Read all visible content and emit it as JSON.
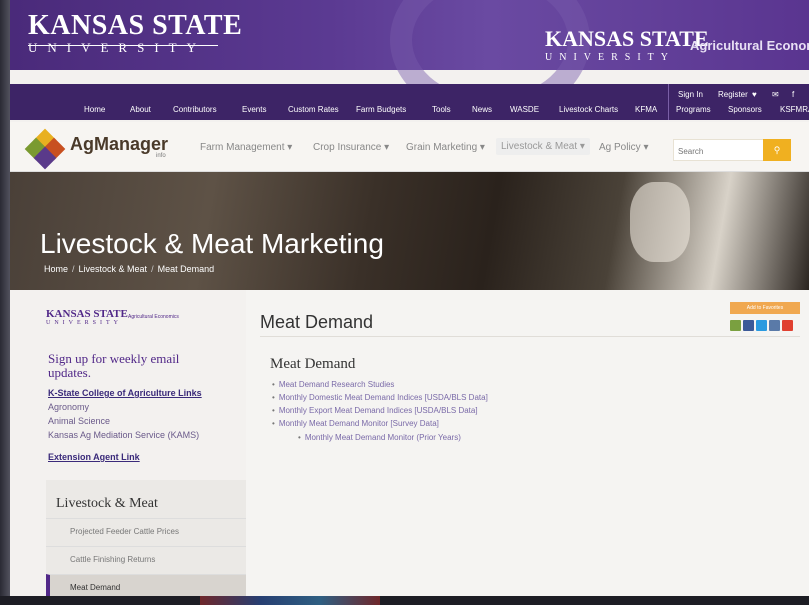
{
  "ksu": {
    "logo_big": "KANSAS STATE",
    "logo_small": "UNIVERSITY",
    "right_big": "KANSAS STATE",
    "right_small": "UNIVERSITY",
    "right_sub": "Agricultural Economic"
  },
  "topnav": {
    "items": [
      "Home",
      "About",
      "Contributors",
      "Events",
      "Custom Rates",
      "Farm Budgets",
      "Tools",
      "News",
      "WASDE",
      "Livestock Charts",
      "KFMA",
      "Programs",
      "Sponsors",
      "KSFMRA"
    ],
    "top_right": [
      "Sign In",
      "Register"
    ]
  },
  "agmanager": {
    "name": "AgManager",
    "sub": "info",
    "menus": [
      "Farm Management ▾",
      "Crop Insurance ▾",
      "Grain Marketing ▾",
      "Livestock & Meat ▾",
      "Ag Policy ▾"
    ],
    "search_placeholder": "Search",
    "search_icon": "search-icon"
  },
  "hero": {
    "title": "Livestock & Meat Marketing",
    "crumbs": [
      "Home",
      "Livestock & Meat",
      "Meat Demand"
    ]
  },
  "sidebar": {
    "logo_big": "KANSAS STATE",
    "logo_small": "UNIVERSITY",
    "logo_sub": "Agricultural Economics",
    "signup": "Sign up for weekly email updates.",
    "links": [
      "K-State College of Agriculture Links",
      "Agronomy",
      "Animal Science",
      "Kansas Ag Mediation Service (KAMS)",
      "Extension Agent Link"
    ],
    "section_title": "Livestock & Meat",
    "items": [
      "Projected Feeder Cattle Prices",
      "Cattle Finishing Returns",
      "Meat Demand"
    ]
  },
  "main": {
    "title": "Meat Demand",
    "fav_button": "Add to Favorites",
    "section_title": "Meat Demand",
    "list": [
      "Meat Demand Research Studies",
      "Monthly Domestic Meat Demand Indices [USDA/BLS Data]",
      "Monthly Export Meat Demand Indices [USDA/BLS Data]",
      "Monthly Meat Demand Monitor [Survey Data]"
    ],
    "sublist": [
      "Monthly Meat Demand Monitor (Prior Years)"
    ]
  },
  "colors": {
    "ksu_purple": "#512888",
    "search_accent": "#f0b020",
    "fav_button": "#f0a850"
  }
}
